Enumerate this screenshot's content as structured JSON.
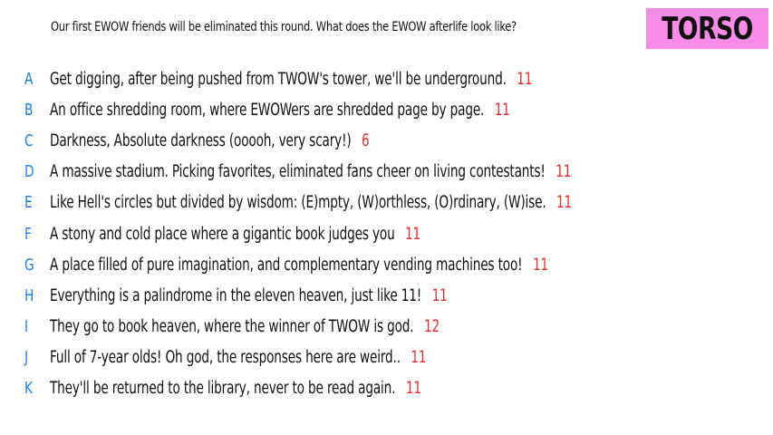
{
  "header": {
    "prompt": "Our first EWOW friends will be eliminated this round. What does the EWOW afterlife look like?",
    "badge": "TORSO"
  },
  "colors": {
    "letter": "#1f7fe0",
    "count": "#e23030",
    "badge_bg": "#f78ce8"
  },
  "responses": [
    {
      "letter": "A",
      "text": "Get digging, after being pushed from TWOW's tower, we'll be underground.",
      "count": "11"
    },
    {
      "letter": "B",
      "text": "An office shredding room, where EWOWers are shredded page by page.",
      "count": "11"
    },
    {
      "letter": "C",
      "text": "Darkness, Absolute darkness (ooooh, very scary!)",
      "count": "6"
    },
    {
      "letter": "D",
      "text": "A massive stadium. Picking favorites, eliminated fans cheer on living contestants!",
      "count": "11"
    },
    {
      "letter": "E",
      "text": "Like Hell's circles but divided by wisdom: (E)mpty, (W)orthless, (O)rdinary, (W)ise.",
      "count": "11"
    },
    {
      "letter": "F",
      "text": "A stony and cold place where a gigantic book judges you",
      "count": "11"
    },
    {
      "letter": "G",
      "text": "A place filled of pure imagination, and complementary vending machines too!",
      "count": "11"
    },
    {
      "letter": "H",
      "text": "Everything is a palindrome in the eleven heaven, just like 11!",
      "count": "11"
    },
    {
      "letter": "I",
      "text": "They go to book heaven, where the winner of TWOW is god.",
      "count": "12"
    },
    {
      "letter": "J",
      "text": "Full of 7-year olds! Oh god, the responses here are weird..",
      "count": "11"
    },
    {
      "letter": "K",
      "text": "They'll be returned to the library, never to be read again.",
      "count": "11"
    }
  ]
}
